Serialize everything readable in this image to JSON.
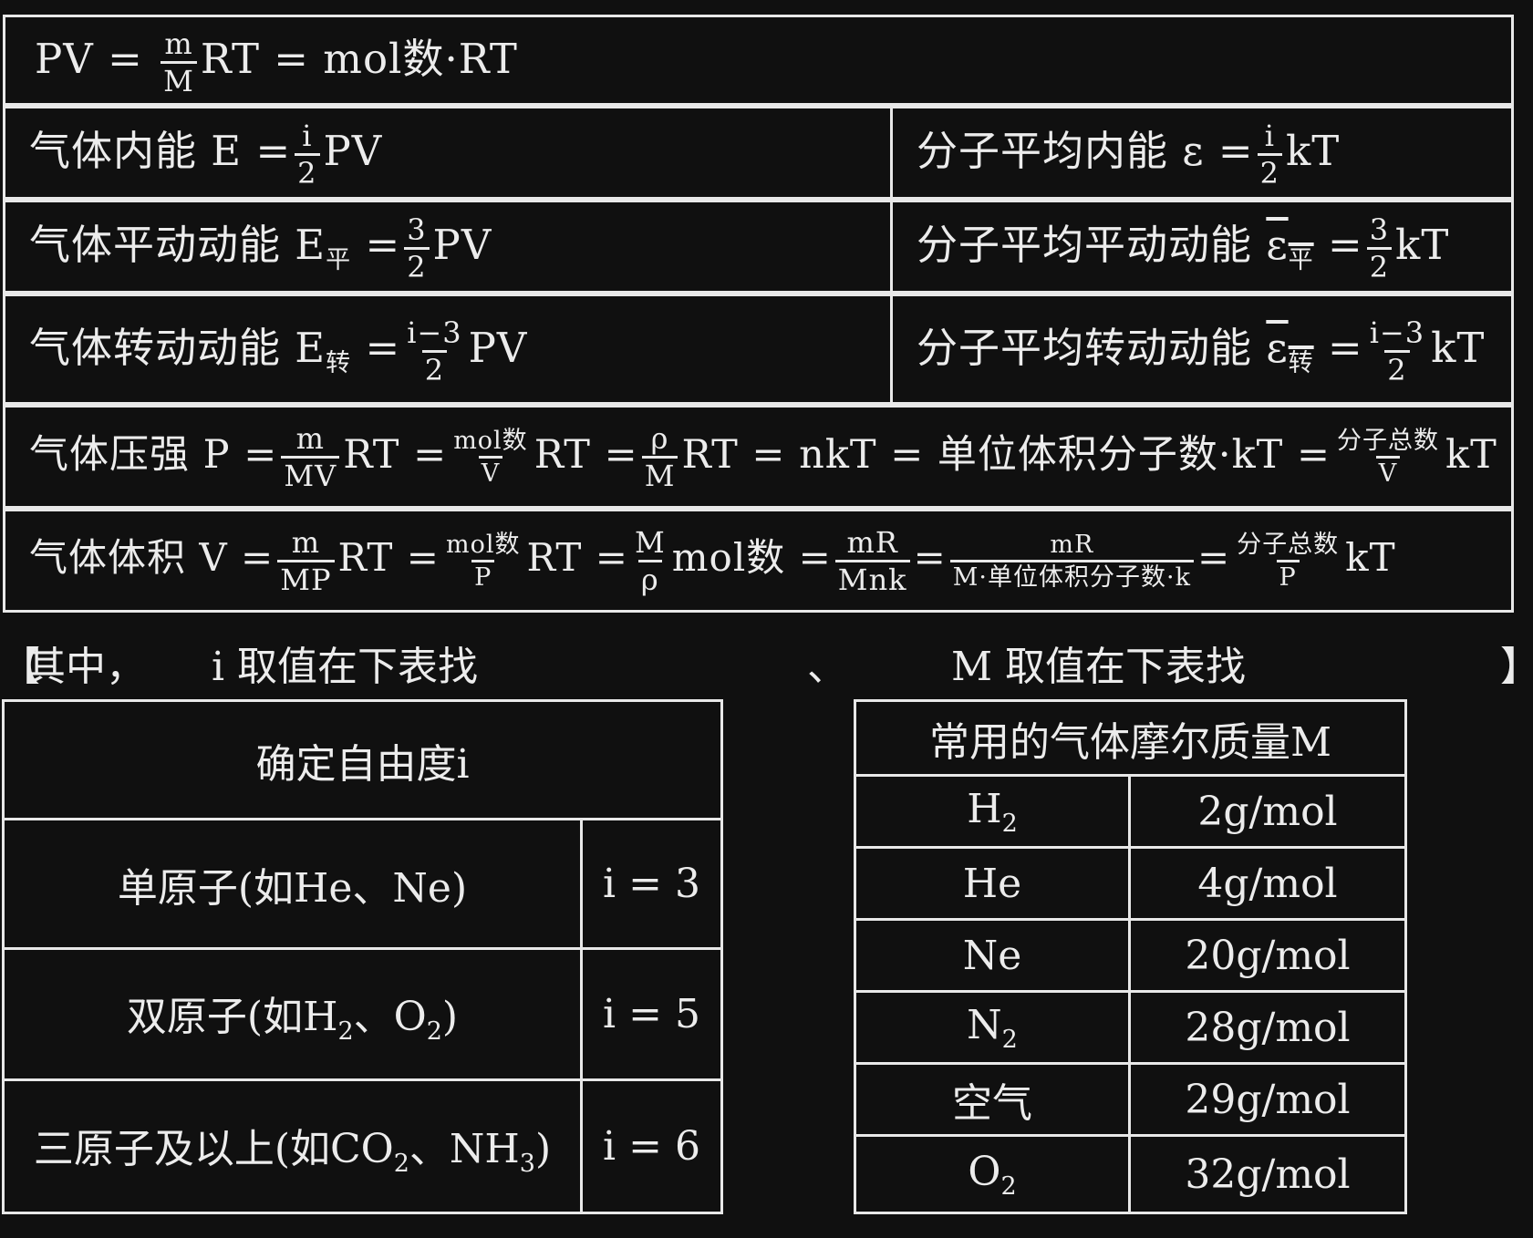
{
  "formulas": {
    "r1": {
      "lhs": "PV =",
      "f1_num": "m",
      "f1_den": "M",
      "rest": "RT = mol数·RT"
    },
    "r2_left": {
      "label": "气体内能 E =",
      "f_num": "i",
      "f_den": "2",
      "rest": "PV"
    },
    "r2_right": {
      "label": "分子平均内能 ε =",
      "f_num": "i",
      "f_den": "2",
      "rest": "kT"
    },
    "r3_left": {
      "label": "气体平动动能 E",
      "sub": "平",
      "eq": "=",
      "f_num": "3",
      "f_den": "2",
      "rest": "PV"
    },
    "r3_right": {
      "label": "分子平均平动动能",
      "sym": "ε",
      "sub": "平",
      "eq": "=",
      "f_num": "3",
      "f_den": "2",
      "rest": "kT"
    },
    "r4_left": {
      "label": "气体转动动能 E",
      "sub": "转",
      "eq": "=",
      "f_num": "i−3",
      "f_den": "2",
      "rest": "PV"
    },
    "r4_right": {
      "label": "分子平均转动动能",
      "sym": "ε",
      "sub": "转",
      "eq": "=",
      "f_num": "i−3",
      "f_den": "2",
      "rest": "kT"
    },
    "r5": {
      "label": "气体压强 P =",
      "a_num": "m",
      "a_den": "MV",
      "a_rest": "RT =",
      "b_num": "mol数",
      "b_den": "V",
      "b_rest": "RT =",
      "c_num": "ρ",
      "c_den": "M",
      "c_rest": "RT = nkT = 单位体积分子数·kT =",
      "d_num": "分子总数",
      "d_den": "V",
      "d_rest": "kT"
    },
    "r6": {
      "label": "气体体积 V =",
      "a_num": "m",
      "a_den": "MP",
      "a_rest": "RT =",
      "b_num": "mol数",
      "b_den": "P",
      "b_rest": "RT =",
      "c_num": "M",
      "c_den": "ρ",
      "c_rest": "mol数 =",
      "d_num": "mR",
      "d_den": "Mnk",
      "d_rest": "=",
      "e_num": "mR",
      "e_den": "M·单位体积分子数·k",
      "e_rest": "=",
      "f_num": "分子总数",
      "f_den": "P",
      "f_rest": "kT"
    }
  },
  "note": {
    "open": "【",
    "prefix": "其中，",
    "left": "i 取值在下表找",
    "sep": "、",
    "right": "M 取值在下表找",
    "close": "】"
  },
  "dof_table": {
    "header": "确定自由度i",
    "rows": [
      {
        "label": "单原子(如He、Ne)",
        "value": "i = 3"
      },
      {
        "label_html": [
          "双原子(如H",
          "2",
          "、O",
          "2",
          ")"
        ],
        "value": "i = 5"
      },
      {
        "label_html": [
          "三原子及以上(如CO",
          "2",
          "、NH",
          "3",
          ")"
        ],
        "value": "i = 6"
      }
    ]
  },
  "molar_table": {
    "header": "常用的气体摩尔质量M",
    "rows": [
      {
        "gas": "H",
        "gas_sub": "2",
        "mass": "2g/mol"
      },
      {
        "gas": "He",
        "gas_sub": "",
        "mass": "4g/mol"
      },
      {
        "gas": "Ne",
        "gas_sub": "",
        "mass": "20g/mol"
      },
      {
        "gas": "N",
        "gas_sub": "2",
        "mass": "28g/mol"
      },
      {
        "gas": "空气",
        "gas_sub": "",
        "mass": "29g/mol"
      },
      {
        "gas": "O",
        "gas_sub": "2",
        "mass": "32g/mol"
      }
    ]
  }
}
